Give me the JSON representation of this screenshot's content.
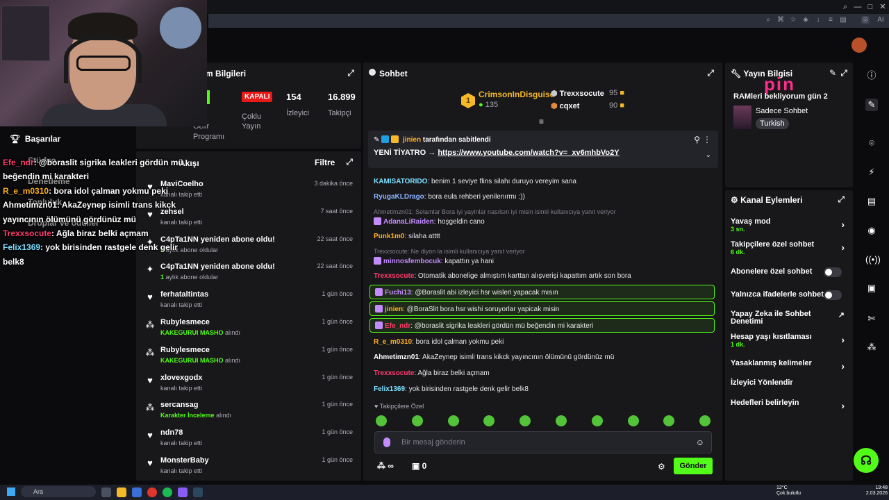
{
  "overlay": {
    "brand_text": "pin",
    "messages": [
      {
        "user": "Efe_ndr",
        "text": ": @boraslit sigrika leakleri gördün mü",
        "color": "#ff3b6b"
      },
      {
        "user": "",
        "text": "beğendin mi karakteri",
        "color": "#fff"
      },
      {
        "user": "R_e_m0310",
        "text": ": bora idol çalman yokmu peki",
        "color": "#ffb020"
      },
      {
        "user": "Ahmetimzn01",
        "text": ": AkaZeynep isimli trans kikck",
        "color": "#fff"
      },
      {
        "user": "",
        "text": "yayıncının ölümünü gördünüz mü",
        "color": "#fff"
      },
      {
        "user": "Trexxsocute",
        "text": ": Ağla biraz belki açmam",
        "color": "#ff3b6b"
      },
      {
        "user": "Felix1369",
        "text": ": yok birisinden rastgele denk gelir",
        "color": "#7ee0ff"
      },
      {
        "user": "",
        "text": "belk8",
        "color": "#fff"
      }
    ],
    "menu": {
      "achievements": "Başarılar",
      "studio": "Stüdyo",
      "test": "Denetleme",
      "topluluk": "Topluluk",
      "droplar": "Droplar ve ödüller"
    }
  },
  "stats": {
    "title": "Stream Bilgileri",
    "partner_lines": [
      "erlik",
      "Gelir",
      "Programı"
    ],
    "status_badge": "KAPALI",
    "status_label": "Çoklu Yayın",
    "viewers_value": "154",
    "viewers_label": "İzleyici",
    "followers_value": "16.899",
    "followers_label": "Takipçi"
  },
  "activity": {
    "title": "Akışı",
    "filter": "Filtre",
    "rows": [
      {
        "icon": "heart-icon",
        "glyph": "♥",
        "name": "MaviCoelho",
        "sub": "kanalı takip etti",
        "hl": "",
        "time": "3 dakika önce"
      },
      {
        "icon": "heart-icon",
        "glyph": "♥",
        "name": "zehsel",
        "sub": "kanalı takip etti",
        "hl": "",
        "time": "7 saat önce"
      },
      {
        "icon": "star-icon",
        "glyph": "✦",
        "name": "C4pTa1NN yeniden abone oldu!",
        "sub": "aylık abone oldular",
        "hl": "1",
        "time": "22 saat önce"
      },
      {
        "icon": "star-icon",
        "glyph": "✦",
        "name": "C4pTa1NN yeniden abone oldu!",
        "sub": "aylık abone oldular",
        "hl": "1",
        "time": "22 saat önce"
      },
      {
        "icon": "heart-icon",
        "glyph": "♥",
        "name": "ferhataltintas",
        "sub": "kanalı takip etti",
        "hl": "",
        "time": "1 gün önce"
      },
      {
        "icon": "points-icon",
        "glyph": "⁂",
        "name": "Rubylesmece",
        "sub": "alındı",
        "hl": "KAKEGURUI MASHO",
        "time": "1 gün önce"
      },
      {
        "icon": "points-icon",
        "glyph": "⁂",
        "name": "Rubylesmece",
        "sub": "alındı",
        "hl": "KAKEGURUI MASHO",
        "time": "1 gün önce"
      },
      {
        "icon": "heart-icon",
        "glyph": "♥",
        "name": "xlovexgodx",
        "sub": "kanalı takip etti",
        "hl": "",
        "time": "1 gün önce"
      },
      {
        "icon": "points-icon",
        "glyph": "⁂",
        "name": "sercansag",
        "sub": "alındı",
        "hl": "Karakter İnceleme",
        "time": "1 gün önce"
      },
      {
        "icon": "heart-icon",
        "glyph": "♥",
        "name": "ndn78",
        "sub": "kanalı takip etti",
        "hl": "",
        "time": "1 gün önce"
      },
      {
        "icon": "heart-icon",
        "glyph": "♥",
        "name": "MonsterBaby",
        "sub": "kanalı takip etti",
        "hl": "",
        "time": "1 gün önce"
      }
    ]
  },
  "chat": {
    "title": "Sohbet",
    "leaders": [
      {
        "name": "CrimsonInDisguise",
        "score": "135"
      },
      {
        "name": "Trexxsocute",
        "score": "95"
      },
      {
        "name": "cqxet",
        "score": "90"
      }
    ],
    "leader_rank": "1",
    "pinned_by": "jinien",
    "pinned_label": "tarafından sabitlendi",
    "pinned_text": "YENİ TİYATRO →",
    "pinned_link": "https://www.youtube.com/watch?v=_xv6mhbVo2Y",
    "messages": [
      {
        "type": "msg",
        "user": "KAMISATORIDO",
        "color": "#7ee0ff",
        "text": ": benim 1 seviye flins silahı duruyo vereyim sana"
      },
      {
        "type": "msg",
        "user": "RyugaKLDrago",
        "color": "#8ab4ff",
        "text": ": bora eula rehberi yenilenırmı :))"
      },
      {
        "type": "reply",
        "text": "Ahmetimzn01: Selamlar Bora iyi yayinlar nasılsın iyi misin isimli kullanıcıya yanıt veriyor"
      },
      {
        "type": "msg",
        "user": "AdanaLiRaiden",
        "color": "#c48bff",
        "text": ": hoşgeldin cano"
      },
      {
        "type": "msg",
        "user": "Punk1m0",
        "color": "#ffb020",
        "text": ": silaha atttt"
      },
      {
        "type": "reply",
        "text": "Trexxsocute: Ne diyon la isimli kullanıcıya yanıt veriyor"
      },
      {
        "type": "msg",
        "user": "minnosfembocuk",
        "color": "#c48bff",
        "text": ": kapattın ya hani"
      },
      {
        "type": "msg",
        "user": "Trexxsocute",
        "color": "#ff3b6b",
        "text": ": Otomatik abonelige almıştım karttan alışverişi kapattım artık son bora"
      },
      {
        "type": "hl",
        "user": "Fuchi13",
        "color": "#c48bff",
        "text": ": @Boraslit abi izleyici hsr wisleri yapacak mısın"
      },
      {
        "type": "hl",
        "user": "jinien",
        "color": "#ffb020",
        "text": ": @BoraSlit bora hsr wishi soruyorlar yapicak misin"
      },
      {
        "type": "hl",
        "user": "Efe_ndr",
        "color": "#ff3b6b",
        "text": ": @boraslit sigrika leakleri gördün mü beğendin mi karakteri"
      },
      {
        "type": "msg",
        "user": "R_e_m0310",
        "color": "#ffb020",
        "text": ": bora idol çalman yokmu peki"
      },
      {
        "type": "msg",
        "user": "Ahmetimzn01",
        "color": "#fff",
        "text": ": AkaZeynep isimli trans kikck yayıncının ölümünü gördünüz mü"
      },
      {
        "type": "msg",
        "user": "Trexxsocute",
        "color": "#ff3b6b",
        "text": ": Ağla biraz belki açmam"
      },
      {
        "type": "msg",
        "user": "Felix1369",
        "color": "#7ee0ff",
        "text": ": yok birisinden rastgele denk gelir belk8"
      }
    ],
    "followers_only": "Takipçilere Özel",
    "input_placeholder": "Bir mesaj gönderin",
    "points_value": "∞",
    "drops_value": "0",
    "send_label": "Gönder"
  },
  "yayin": {
    "title": "Yayın Bilgisi",
    "stream_title": "RAMleri bekliyorum gün 2",
    "category": "Sadece Sohbet",
    "tag": "Turkish"
  },
  "kanal": {
    "title": "Kanal Eylemleri",
    "items": [
      {
        "label": "Yavaş mod",
        "sub": "3 sn.",
        "control": "chevron"
      },
      {
        "label": "Takipçilere özel sohbet",
        "sub": "6 dk.",
        "control": "chevron"
      },
      {
        "label": "Abonelere özel sohbet",
        "sub": "",
        "control": "toggle"
      },
      {
        "label": "Yalnızca ifadelerle sohbet",
        "sub": "",
        "control": "toggle"
      },
      {
        "label": "Yapay Zeka ile Sohbet Denetimi",
        "sub": "",
        "control": "external"
      },
      {
        "label": "Hesap yaşı kısıtlaması",
        "sub": "1 dk.",
        "control": "chevron"
      },
      {
        "label": "Yasaklanmış kelimeler",
        "sub": "",
        "control": "chevron"
      },
      {
        "label": "İzleyici Yönlendir",
        "sub": "",
        "control": "none"
      },
      {
        "label": "Hedefleri belirleyin",
        "sub": "",
        "control": "chevron"
      }
    ]
  },
  "taskbar": {
    "search_placeholder": "Ara",
    "weather_temp": "12°C",
    "weather_desc": "Çok bulutlu",
    "time": "19:48",
    "date": "2.03.2026"
  },
  "colors": {
    "accent": "#53fc18",
    "panel": "#18181b",
    "bg": "#0b0b0d",
    "live_red": "#e91916"
  }
}
